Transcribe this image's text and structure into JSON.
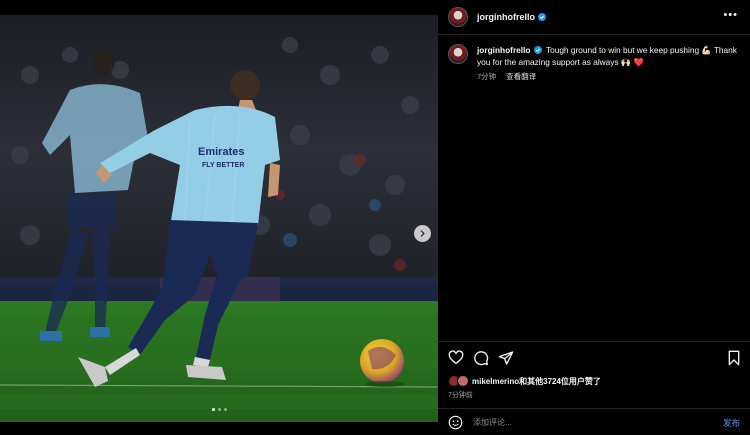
{
  "post": {
    "username": "jorginhofrello",
    "caption": "Tough ground to win but we keep pushing 💪🏻 Thank you for the amazing support as always 🙌🏻 ❤️",
    "time": "7分钟",
    "translate_label": "查看翻译",
    "likes_user": "mikelmerino",
    "likes_rest": "和其他3724位用户赞了",
    "time_ago": "7分钟前",
    "comment_placeholder": "添加评论...",
    "post_label": "发布",
    "more_label": "•••"
  },
  "photo": {
    "alt": "Football player in light-blue kit dribbling ball on pitch",
    "image_count": 3,
    "active_index": 1
  },
  "colors": {
    "background": "#000000",
    "accent_link": "#4e6ea8",
    "verified": "#1d9bf0",
    "like_heart": "#ed4956"
  },
  "icons": [
    "verified-icon",
    "more-icon",
    "next-arrow-icon",
    "heart-icon",
    "comment-icon",
    "share-icon",
    "bookmark-icon",
    "emoji-icon"
  ]
}
